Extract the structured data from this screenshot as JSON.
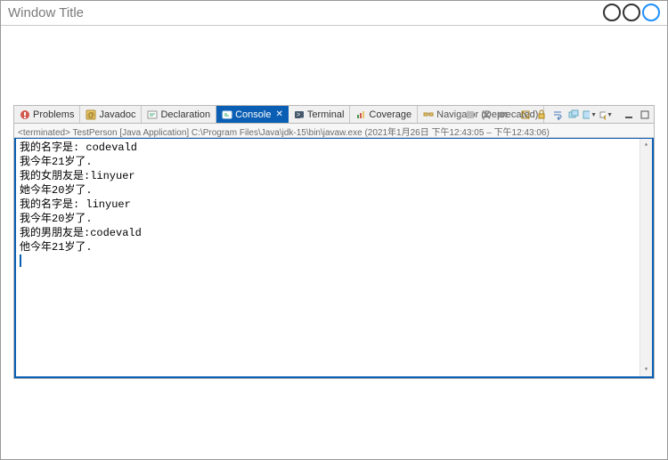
{
  "window": {
    "title": "Window Title"
  },
  "tabs": {
    "problems": {
      "label": "Problems"
    },
    "javadoc": {
      "label": "Javadoc"
    },
    "declaration": {
      "label": "Declaration"
    },
    "console": {
      "label": "Console"
    },
    "terminal": {
      "label": "Terminal"
    },
    "coverage": {
      "label": "Coverage"
    },
    "navigator": {
      "label": "Navigator (Deprecated)"
    }
  },
  "status": {
    "text": "<terminated> TestPerson [Java Application] C:\\Program Files\\Java\\jdk-15\\bin\\javaw.exe  (2021年1月26日 下午12:43:05 – 下午12:43:06)"
  },
  "console": {
    "lines": [
      "我的名字是: codevald",
      "我今年21岁了.",
      "我的女朋友是:linyuer",
      "她今年20岁了.",
      "我的名字是: linyuer",
      "我今年20岁了.",
      "我的男朋友是:codevald",
      "他今年21岁了."
    ]
  },
  "icons": {
    "problems": "problems-icon",
    "javadoc": "javadoc-icon",
    "declaration": "declaration-icon",
    "console": "console-icon",
    "terminal": "terminal-icon",
    "coverage": "coverage-icon",
    "navigator": "navigator-icon"
  }
}
